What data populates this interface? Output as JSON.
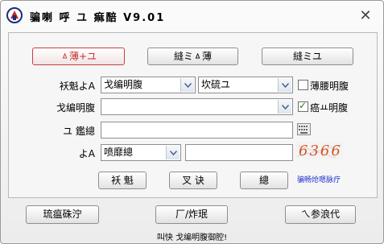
{
  "window": {
    "title": "骗喇 呼 ユ 痲醅 V9.01",
    "close_glyph": "✕"
  },
  "tabs": [
    {
      "label": "ㅿ薄+ユ"
    },
    {
      "label": "縫ミㅿ薄"
    },
    {
      "label": "縫ミユ"
    }
  ],
  "form": {
    "account_label": "袄魁よA",
    "account_type": "戈编明腹",
    "account_server": "坎硫ユ",
    "remember_label": "薄腰明腹",
    "remember_checked": false,
    "id_label": "戈编明腹",
    "id_value": "",
    "auto_label": "癌ㅛ明腹",
    "auto_checked": true,
    "password_label": "ユ 鑑總",
    "password_value": "",
    "captcha_label": "よA",
    "captcha_select": "喷靡總",
    "captcha_value": "",
    "captcha_text": "6366"
  },
  "actions": {
    "login": "袄 魁",
    "reset": "叉 诀",
    "exit": "總",
    "help_link": "骗畅炝嗯脉疗"
  },
  "footer": {
    "left_button": "琉瘟硃泞",
    "center_button": "厂/炸珉",
    "right_button": "ㄟ参浪代",
    "status": "叫快  戈编明腹御腔!"
  },
  "colors": {
    "accent": "#c63030",
    "link": "#2233cc"
  }
}
